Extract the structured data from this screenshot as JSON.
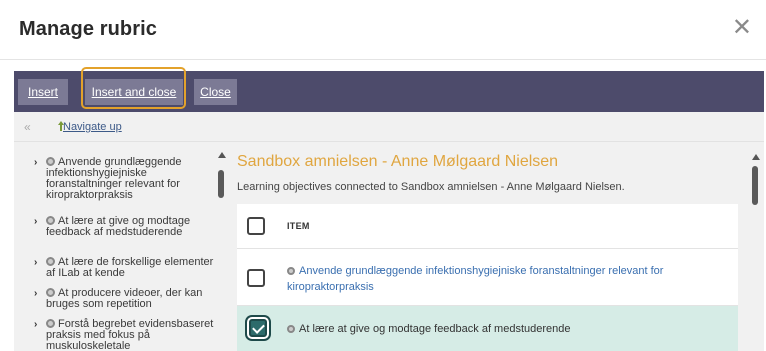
{
  "dialog": {
    "title": "Manage rubric",
    "close_glyph": "✕"
  },
  "toolbar": {
    "insert_label": "Insert",
    "insert_close_label": "Insert and close",
    "close_label": "Close"
  },
  "navbar": {
    "collapse_glyph": "«",
    "navigate_up_label": "Navigate up"
  },
  "tree": {
    "items": [
      {
        "text": "Anvende grundlæggende infektionshygiejniske foranstaltninger relevant for kiropraktorpraksis"
      },
      {
        "text": "At lære at give og modtage feedback af medstuderende"
      },
      {
        "text": "At lære de forskellige elementer af ILab at kende"
      },
      {
        "text": "At producere videoer, der kan bruges som repetition"
      },
      {
        "text": "Forstå begrebet evidensbaseret praksis med fokus på muskuloskeletale"
      }
    ]
  },
  "main": {
    "title": "Sandbox amnielsen - Anne Mølgaard Nielsen",
    "description": "Learning objectives connected to Sandbox amnielsen - Anne Mølgaard Nielsen.",
    "column_item": "ITEM",
    "rows": [
      {
        "text": "Anvende grundlæggende infektionshygiejniske foranstaltninger relevant for kiropraktorpraksis",
        "checked": false
      },
      {
        "text": "At lære at give og modtage feedback af medstuderende",
        "checked": true
      }
    ]
  },
  "colors": {
    "toolbar": "#4d4b6b",
    "focus": "#e3a22b",
    "title_accent": "#e0a640",
    "link": "#3a6fb0",
    "selected_row": "#d6ece6"
  }
}
